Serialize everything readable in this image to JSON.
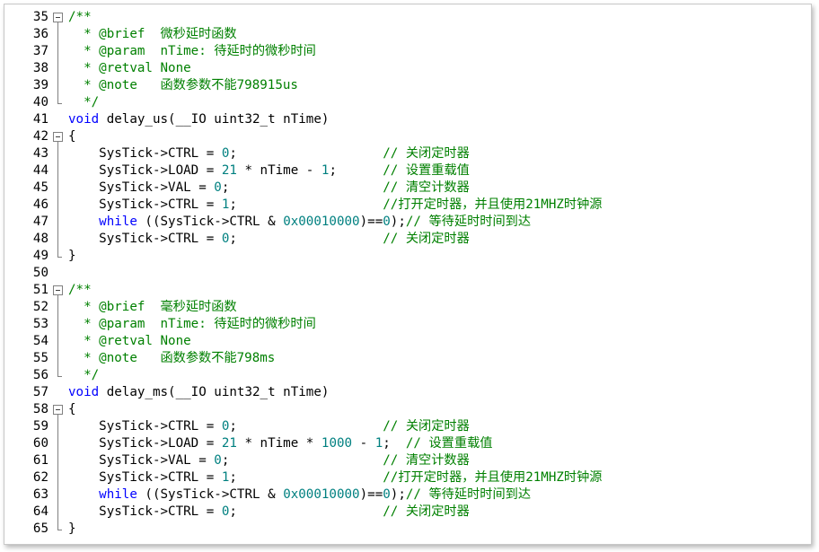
{
  "editor": {
    "lines": [
      {
        "n": "35",
        "fold": "start",
        "segs": [
          {
            "t": "/**",
            "c": "cm"
          }
        ]
      },
      {
        "n": "36",
        "fold": "line",
        "segs": [
          {
            "t": "  * @brief  微秒延时函数",
            "c": "cm"
          }
        ]
      },
      {
        "n": "37",
        "fold": "line",
        "segs": [
          {
            "t": "  * @param  nTime: 待延时的微秒时间",
            "c": "cm"
          }
        ]
      },
      {
        "n": "38",
        "fold": "line",
        "segs": [
          {
            "t": "  * @retval None",
            "c": "cm"
          }
        ]
      },
      {
        "n": "39",
        "fold": "line",
        "segs": [
          {
            "t": "  * @note   函数参数不能798915us",
            "c": "cm"
          }
        ]
      },
      {
        "n": "40",
        "fold": "end",
        "segs": [
          {
            "t": "  */",
            "c": "cm"
          }
        ]
      },
      {
        "n": "41",
        "fold": "",
        "segs": [
          {
            "t": "void",
            "c": "kw"
          },
          {
            "t": " delay_us(__IO uint32_t nTime)",
            "c": "pl"
          }
        ]
      },
      {
        "n": "42",
        "fold": "start",
        "segs": [
          {
            "t": "{",
            "c": "pl"
          }
        ]
      },
      {
        "n": "43",
        "fold": "line",
        "segs": [
          {
            "t": "    SysTick->CTRL = ",
            "c": "pl"
          },
          {
            "t": "0",
            "c": "num"
          },
          {
            "t": ";                   ",
            "c": "pl"
          },
          {
            "t": "// 关闭定时器",
            "c": "cm"
          }
        ]
      },
      {
        "n": "44",
        "fold": "line",
        "segs": [
          {
            "t": "    SysTick->LOAD = ",
            "c": "pl"
          },
          {
            "t": "21",
            "c": "num"
          },
          {
            "t": " * nTime - ",
            "c": "pl"
          },
          {
            "t": "1",
            "c": "num"
          },
          {
            "t": ";      ",
            "c": "pl"
          },
          {
            "t": "// 设置重载值",
            "c": "cm"
          }
        ]
      },
      {
        "n": "45",
        "fold": "line",
        "segs": [
          {
            "t": "    SysTick->VAL = ",
            "c": "pl"
          },
          {
            "t": "0",
            "c": "num"
          },
          {
            "t": ";                    ",
            "c": "pl"
          },
          {
            "t": "// 清空计数器",
            "c": "cm"
          }
        ]
      },
      {
        "n": "46",
        "fold": "line",
        "segs": [
          {
            "t": "    SysTick->CTRL = ",
            "c": "pl"
          },
          {
            "t": "1",
            "c": "num"
          },
          {
            "t": ";                   ",
            "c": "pl"
          },
          {
            "t": "//打开定时器，并且使用21MHZ时钟源",
            "c": "cm"
          }
        ]
      },
      {
        "n": "47",
        "fold": "line",
        "segs": [
          {
            "t": "    ",
            "c": "pl"
          },
          {
            "t": "while",
            "c": "kw"
          },
          {
            "t": " ((SysTick->CTRL & ",
            "c": "pl"
          },
          {
            "t": "0x00010000",
            "c": "num"
          },
          {
            "t": ")==",
            "c": "pl"
          },
          {
            "t": "0",
            "c": "num"
          },
          {
            "t": ");",
            "c": "pl"
          },
          {
            "t": "// 等待延时时间到达",
            "c": "cm"
          }
        ]
      },
      {
        "n": "48",
        "fold": "line",
        "segs": [
          {
            "t": "    SysTick->CTRL = ",
            "c": "pl"
          },
          {
            "t": "0",
            "c": "num"
          },
          {
            "t": ";                   ",
            "c": "pl"
          },
          {
            "t": "// 关闭定时器",
            "c": "cm"
          }
        ]
      },
      {
        "n": "49",
        "fold": "end",
        "segs": [
          {
            "t": "}",
            "c": "pl"
          }
        ]
      },
      {
        "n": "50",
        "fold": "",
        "segs": [
          {
            "t": "",
            "c": "pl"
          }
        ]
      },
      {
        "n": "51",
        "fold": "start",
        "segs": [
          {
            "t": "/**",
            "c": "cm"
          }
        ]
      },
      {
        "n": "52",
        "fold": "line",
        "segs": [
          {
            "t": "  * @brief  毫秒延时函数",
            "c": "cm"
          }
        ]
      },
      {
        "n": "53",
        "fold": "line",
        "segs": [
          {
            "t": "  * @param  nTime: 待延时的微秒时间",
            "c": "cm"
          }
        ]
      },
      {
        "n": "54",
        "fold": "line",
        "segs": [
          {
            "t": "  * @retval None",
            "c": "cm"
          }
        ]
      },
      {
        "n": "55",
        "fold": "line",
        "segs": [
          {
            "t": "  * @note   函数参数不能798ms",
            "c": "cm"
          }
        ]
      },
      {
        "n": "56",
        "fold": "end",
        "segs": [
          {
            "t": "  */",
            "c": "cm"
          }
        ]
      },
      {
        "n": "57",
        "fold": "",
        "segs": [
          {
            "t": "void",
            "c": "kw"
          },
          {
            "t": " delay_ms(__IO uint32_t nTime)",
            "c": "pl"
          }
        ]
      },
      {
        "n": "58",
        "fold": "start",
        "segs": [
          {
            "t": "{",
            "c": "pl"
          }
        ]
      },
      {
        "n": "59",
        "fold": "line",
        "segs": [
          {
            "t": "    SysTick->CTRL = ",
            "c": "pl"
          },
          {
            "t": "0",
            "c": "num"
          },
          {
            "t": ";                   ",
            "c": "pl"
          },
          {
            "t": "// 关闭定时器",
            "c": "cm"
          }
        ]
      },
      {
        "n": "60",
        "fold": "line",
        "segs": [
          {
            "t": "    SysTick->LOAD = ",
            "c": "pl"
          },
          {
            "t": "21",
            "c": "num"
          },
          {
            "t": " * nTime * ",
            "c": "pl"
          },
          {
            "t": "1000",
            "c": "num"
          },
          {
            "t": " - ",
            "c": "pl"
          },
          {
            "t": "1",
            "c": "num"
          },
          {
            "t": ";  ",
            "c": "pl"
          },
          {
            "t": "// 设置重载值",
            "c": "cm"
          }
        ]
      },
      {
        "n": "61",
        "fold": "line",
        "segs": [
          {
            "t": "    SysTick->VAL = ",
            "c": "pl"
          },
          {
            "t": "0",
            "c": "num"
          },
          {
            "t": ";                    ",
            "c": "pl"
          },
          {
            "t": "// 清空计数器",
            "c": "cm"
          }
        ]
      },
      {
        "n": "62",
        "fold": "line",
        "segs": [
          {
            "t": "    SysTick->CTRL = ",
            "c": "pl"
          },
          {
            "t": "1",
            "c": "num"
          },
          {
            "t": ";                   ",
            "c": "pl"
          },
          {
            "t": "//打开定时器，并且使用21MHZ时钟源",
            "c": "cm"
          }
        ]
      },
      {
        "n": "63",
        "fold": "line",
        "segs": [
          {
            "t": "    ",
            "c": "pl"
          },
          {
            "t": "while",
            "c": "kw"
          },
          {
            "t": " ((SysTick->CTRL & ",
            "c": "pl"
          },
          {
            "t": "0x00010000",
            "c": "num"
          },
          {
            "t": ")==",
            "c": "pl"
          },
          {
            "t": "0",
            "c": "num"
          },
          {
            "t": ");",
            "c": "pl"
          },
          {
            "t": "// 等待延时时间到达",
            "c": "cm"
          }
        ]
      },
      {
        "n": "64",
        "fold": "line",
        "segs": [
          {
            "t": "    SysTick->CTRL = ",
            "c": "pl"
          },
          {
            "t": "0",
            "c": "num"
          },
          {
            "t": ";                   ",
            "c": "pl"
          },
          {
            "t": "// 关闭定时器",
            "c": "cm"
          }
        ]
      },
      {
        "n": "65",
        "fold": "end",
        "segs": [
          {
            "t": "}",
            "c": "pl"
          }
        ]
      }
    ]
  },
  "colors": {
    "keyword": "#0000ff",
    "number": "#008080",
    "comment": "#008000",
    "text": "#000000"
  }
}
